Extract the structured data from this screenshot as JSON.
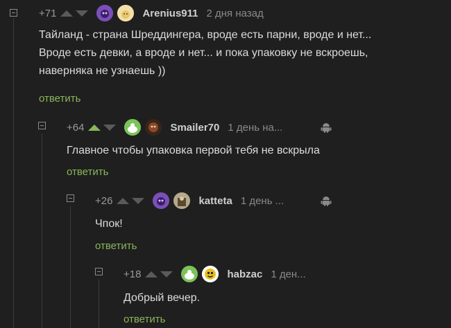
{
  "comments": [
    {
      "rating": "+71",
      "username": "Arenius911",
      "time": "2 дня назад",
      "text": "Тайланд - страна Шреддингера, вроде есть парни, вроде и нет...\nВроде есть девки, а вроде и нет... и пока упаковку не вскроешь,\nнаверняка не узнаешь ))",
      "reply_label": "ответить"
    },
    {
      "rating": "+64",
      "username": "Smailer70",
      "time": "1 день на...",
      "text": "Главное чтобы упаковка первой тебя не вскрыла",
      "reply_label": "ответить"
    },
    {
      "rating": "+26",
      "username": "katteta",
      "time": "1 день ...",
      "text": "Чпок!",
      "reply_label": "ответить"
    },
    {
      "rating": "+18",
      "username": "habzac",
      "time": "1 ден...",
      "text": "Добрый вечер.",
      "reply_label": "ответить"
    }
  ],
  "colors": {
    "background": "#1f1f1f",
    "accent": "#8ab65a",
    "muted": "#8a8a8a"
  }
}
